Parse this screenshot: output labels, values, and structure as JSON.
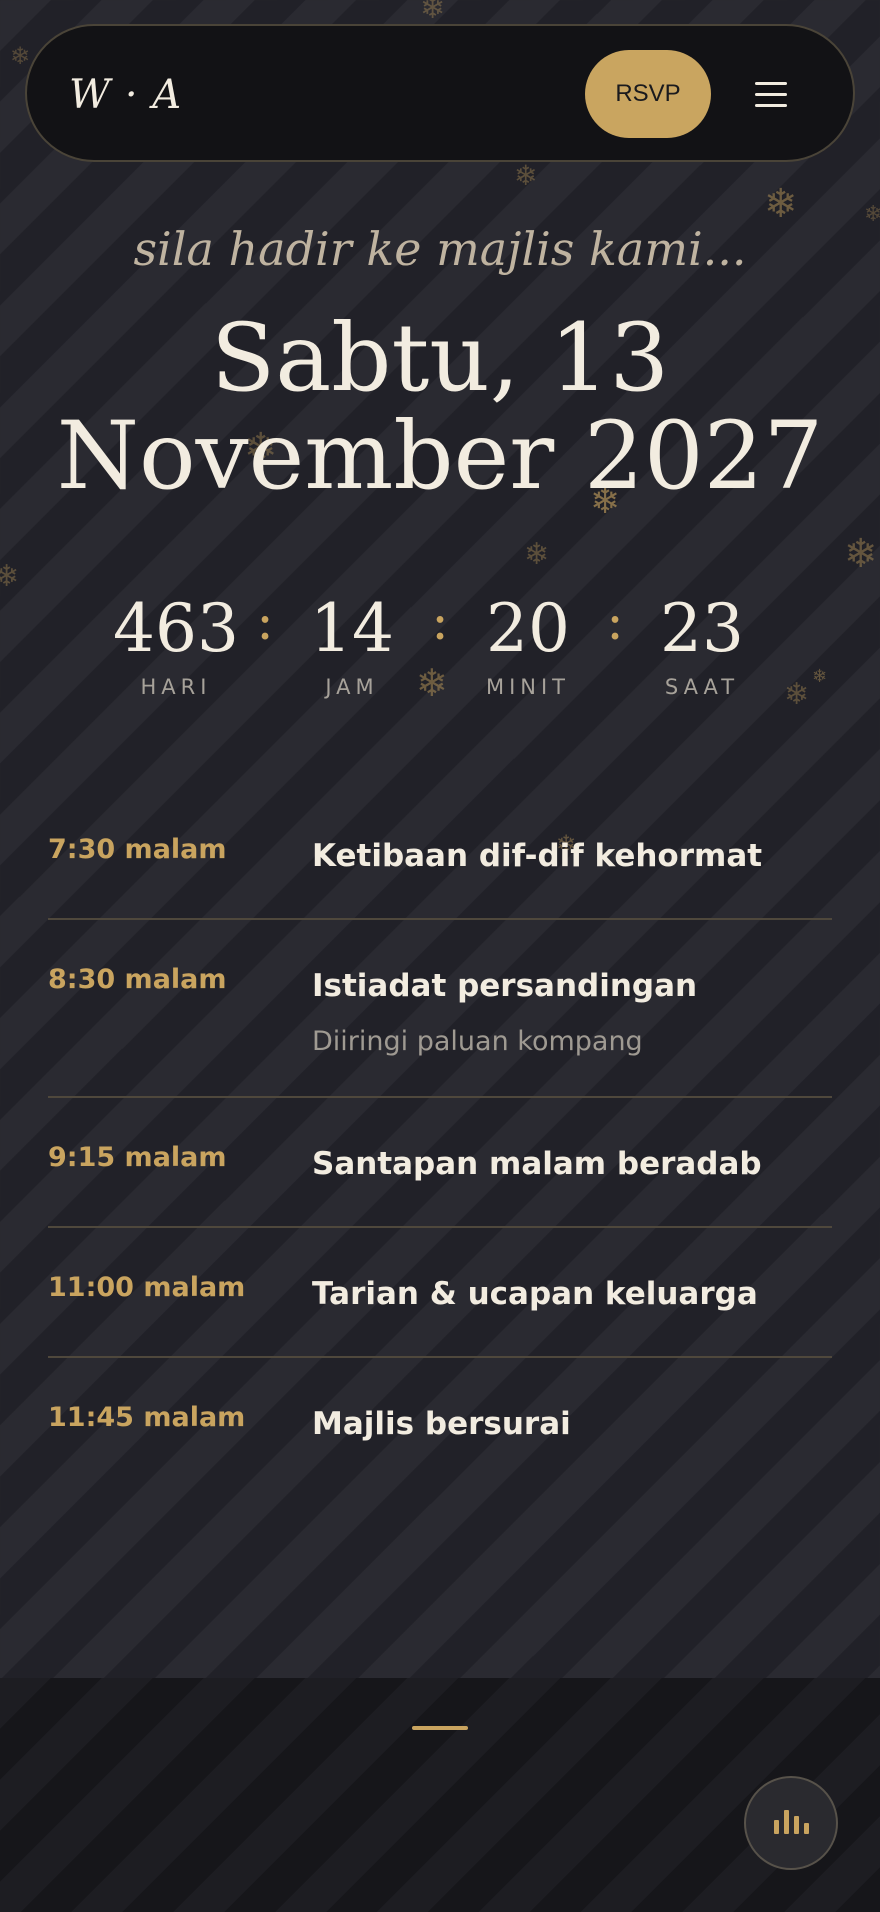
{
  "header": {
    "logo": "W · A",
    "rsvp_label": "RSVP",
    "menu_icon": "hamburger-menu-icon"
  },
  "invite": {
    "tagline": "sila hadir ke majlis kami...",
    "date_line1": "Sabtu, 13",
    "date_line2": "November 2027"
  },
  "countdown": [
    {
      "value": "463",
      "label": "HARI"
    },
    {
      "value": "14",
      "label": "JAM"
    },
    {
      "value": "20",
      "label": "MINIT"
    },
    {
      "value": "23",
      "label": "SAAT"
    }
  ],
  "countdown_separator": ":",
  "schedule": [
    {
      "time": "7:30 malam",
      "title": "Ketibaan dif-dif kehormat"
    },
    {
      "time": "8:30 malam",
      "title": "Istiadat persandingan",
      "subtitle": "Diiringi paluan kompang"
    },
    {
      "time": "9:15 malam",
      "title": "Santapan malam beradab"
    },
    {
      "time": "11:00 malam",
      "title": "Tarian & ucapan keluarga"
    },
    {
      "time": "11:45 malam",
      "title": "Majlis bersurai"
    }
  ],
  "footer": {
    "fab_icon": "audio-bars-icon"
  },
  "colors": {
    "background": "#24242b",
    "accent_gold": "#c9a560",
    "text_cream": "#f2ece0",
    "muted_text": "#9f9a92"
  },
  "decoration_icon": "snowflake-icon"
}
